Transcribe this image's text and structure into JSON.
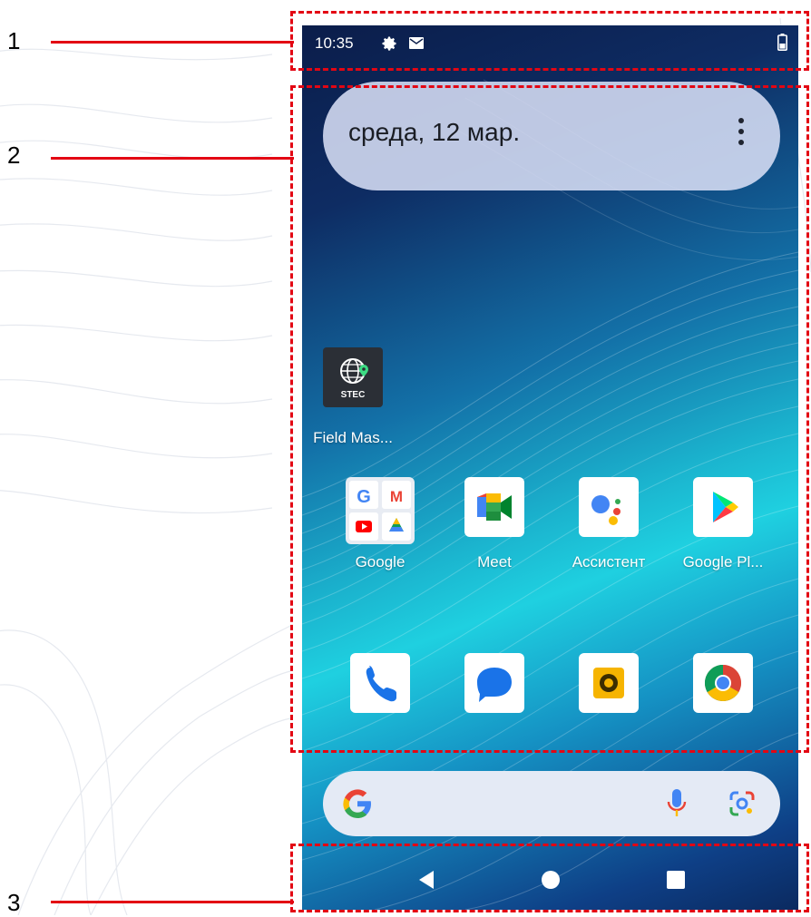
{
  "callouts": {
    "one": "1",
    "two": "2",
    "three": "3"
  },
  "colors": {
    "annotation_red": "#e30613",
    "status_text": "#ffffff",
    "pill_bg": "#d7def5"
  },
  "status_bar": {
    "time": "10:35",
    "icons": [
      "gear-icon",
      "mail-icon",
      "battery-icon"
    ]
  },
  "date_widget": {
    "date": "среда, 12 мар.",
    "menu_icon": "more-vert-icon"
  },
  "apps": {
    "row1": [
      {
        "label": "Field Mas...",
        "icon": "stec-globe-icon",
        "badge": "STEC"
      }
    ],
    "row2": [
      {
        "label": "Google",
        "icon": "google-folder-icon"
      },
      {
        "label": "Meet",
        "icon": "meet-icon"
      },
      {
        "label": "Ассистент",
        "icon": "assistant-icon"
      },
      {
        "label": "Google Pl...",
        "icon": "play-store-icon"
      }
    ],
    "dock": [
      {
        "name": "phone",
        "icon": "phone-icon"
      },
      {
        "name": "messages",
        "icon": "messages-icon"
      },
      {
        "name": "camera",
        "icon": "camera-icon"
      },
      {
        "name": "chrome",
        "icon": "chrome-icon"
      }
    ]
  },
  "search_bar": {
    "left_icon": "google-g-icon",
    "mic_icon": "mic-icon",
    "lens_icon": "lens-icon"
  },
  "nav_bar": {
    "icons": [
      "back-icon",
      "home-icon",
      "recents-icon"
    ]
  }
}
